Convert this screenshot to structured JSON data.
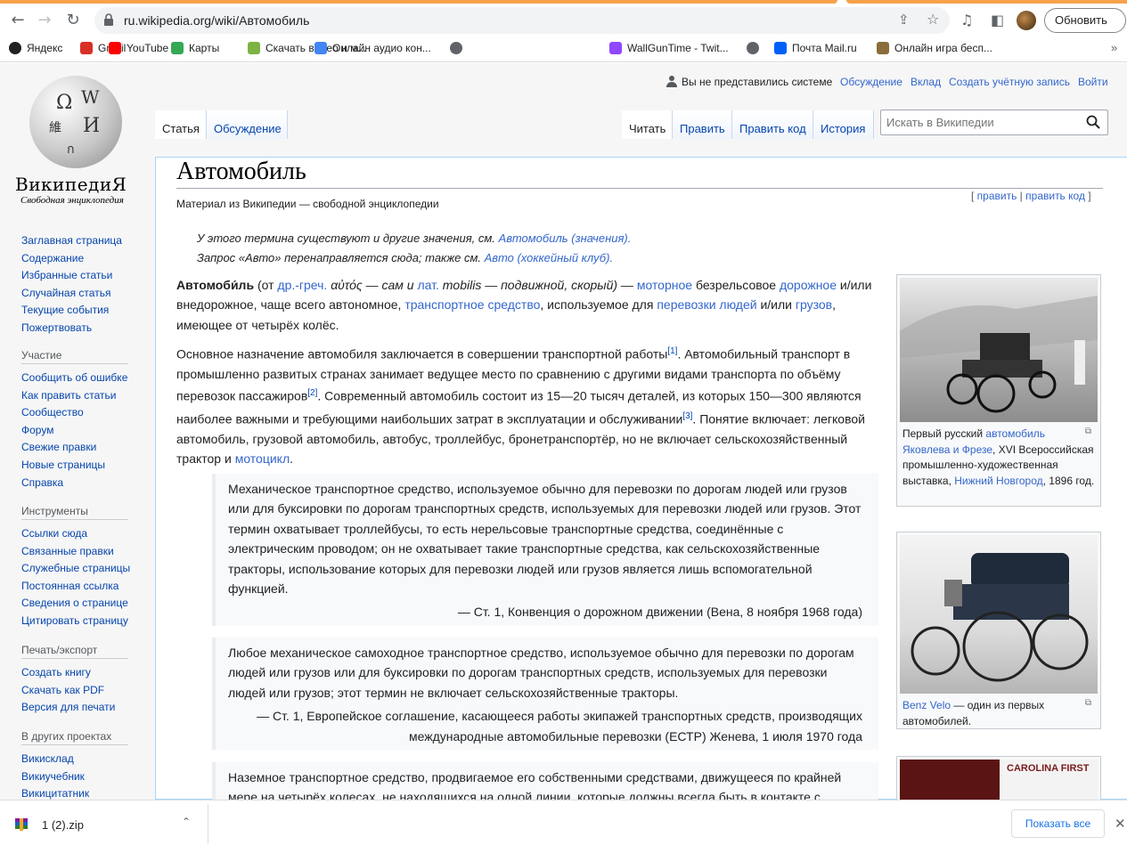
{
  "browser": {
    "url": "ru.wikipedia.org/wiki/Автомобиль",
    "update_button": "Обновить",
    "bookmarks": [
      {
        "label": "Яндекс",
        "icon": "yandex-icon",
        "color": "#202124"
      },
      {
        "label": "Gmail",
        "icon": "gmail-icon",
        "color": "#d93025"
      },
      {
        "label": "YouTube",
        "icon": "youtube-icon",
        "color": "#ff0000"
      },
      {
        "label": "Карты",
        "icon": "maps-icon",
        "color": "#34a853"
      },
      {
        "label": "Скачать видео и м...",
        "icon": "download-icon",
        "color": "#7cb342"
      },
      {
        "label": "Онлайн аудио кон...",
        "icon": "audio-icon",
        "color": "#4285f4"
      },
      {
        "label": "",
        "icon": "globe-icon",
        "color": "#5f6368"
      },
      {
        "label": "WallGunTime - Twit...",
        "icon": "twitch-icon",
        "color": "#9146ff"
      },
      {
        "label": "",
        "icon": "globe-icon",
        "color": "#5f6368"
      },
      {
        "label": "Почта Mail.ru",
        "icon": "mail-icon",
        "color": "#005ff9"
      },
      {
        "label": "Онлайн игра бесп...",
        "icon": "game-icon",
        "color": "#8a6d3b"
      }
    ]
  },
  "wiki": {
    "wordmark": "ВикипедиЯ",
    "tagline": "Свободная энциклопедия",
    "personal": {
      "not_logged": "Вы не представились системе",
      "talk": "Обсуждение",
      "contrib": "Вклад",
      "create": "Создать учётную запись",
      "login": "Войти"
    },
    "tabs": {
      "article": "Статья",
      "discussion": "Обсуждение",
      "read": "Читать",
      "edit": "Править",
      "edit_code": "Править код",
      "history": "История"
    },
    "search_placeholder": "Искать в Википедии",
    "nav_main": [
      "Заглавная страница",
      "Содержание",
      "Избранные статьи",
      "Случайная статья",
      "Текущие события",
      "Пожертвовать"
    ],
    "participation": {
      "heading": "Участие",
      "links": [
        "Сообщить об ошибке",
        "Как править статьи",
        "Сообщество",
        "Форум",
        "Свежие правки",
        "Новые страницы",
        "Справка"
      ]
    },
    "tools": {
      "heading": "Инструменты",
      "links": [
        "Ссылки сюда",
        "Связанные правки",
        "Служебные страницы",
        "Постоянная ссылка",
        "Сведения о странице",
        "Цитировать страницу"
      ]
    },
    "print": {
      "heading": "Печать/экспорт",
      "links": [
        "Создать книгу",
        "Скачать как PDF",
        "Версия для печати"
      ]
    },
    "projects": {
      "heading": "В других проектах",
      "links": [
        "Викисклад",
        "Викиучебник",
        "Викицитатник"
      ]
    }
  },
  "article": {
    "title": "Автомобиль",
    "edit": "править",
    "edit_code": "править код",
    "site_sub": "Материал из Википедии — свободной энциклопедии",
    "hatnote1_text": "У этого термина существуют и другие значения, см.",
    "hatnote1_link": "Автомобиль (значения).",
    "hatnote2_text": "Запрос «Авто» перенаправляется сюда; также см.",
    "hatnote2_link": "Авто (хоккейный клуб).",
    "intro": {
      "bold": "Автомоби́ль",
      "t1": " (от ",
      "greek": "др.-греч.",
      "t2": " αὐτός — сам и ",
      "lat": "лат.",
      "t3": " mobilis — подвижной, скорый) — ",
      "motor": "моторное",
      "t4": " безрельсовое ",
      "road": "дорожное",
      "t5": " и/или внедорожное, чаще всего автономное, ",
      "transport": "транспортное средство",
      "t6": ", используемое для ",
      "people": "перевозки людей",
      "t7": " и/или ",
      "cargo": "грузов",
      "t8": ", имеющее от четырёх колёс."
    },
    "para2": {
      "t1": "Основное назначение автомобиля заключается в совершении транспортной работы",
      "ref1": "[1]",
      "t2": ". Автомобильный транспорт в промышленно развитых странах занимает ведущее место по сравнению с другими видами транспорта по объёму перевозок пассажиров",
      "ref2": "[2]",
      "t3": ". Современный автомобиль состоит из 15—20 тысяч деталей, из которых 150—300 являются наиболее важными и требующими наибольших затрат в эксплуатации и обслуживании",
      "ref3": "[3]",
      "t4": ". Понятие включает: легковой автомобиль, грузовой автомобиль, автобус, троллейбус, бронетранспортёр, но не включает сельскохозяйственный трактор и ",
      "moto": "мотоцикл",
      "t5": "."
    },
    "quote1": {
      "text": "Механическое транспортное средство, используемое обычно для перевозки по дорогам людей или грузов или для буксировки по дорогам транспортных средств, используемых для перевозки людей или грузов. Этот термин охватывает троллейбусы, то есть нерельсовые транспортные средства, соединённые с электрическим проводом; он не охватывает такие транспортные средства, как сельскохозяйственные тракторы, использование которых для перевозки людей или грузов является лишь вспомогательной функцией.",
      "source": "— Ст. 1, Конвенция о дорожном движении (Вена, 8 ноября 1968 года)"
    },
    "quote2": {
      "text": "Любое механическое самоходное транспортное средство, используемое обычно для перевозки по дорогам людей или грузов или для буксировки по дорогам транспортных средств, используемых для перевозки людей или грузов; этот термин не включает сельскохозяйственные тракторы.",
      "source": "— Ст. 1, Европейское соглашение, касающееся работы экипажей транспортных средств, производящих международные автомобильные перевозки (ЕСТР) Женева, 1 июля 1970 года"
    },
    "quote3": {
      "text": "Наземное транспортное средство, продвигаемое его собственными средствами, движущееся по крайней мере на четырёх колесах, не находящихся на одной линии, которые должны всегда быть в контакте с"
    },
    "thumb1": {
      "c1": "Первый русский ",
      "link1": "автомобиль Яковлева и Фрезе",
      "c2": ", XVI Всероссийская промышленно-художественная выставка, ",
      "link2": "Нижний Новгород",
      "c3": ", 1896 год."
    },
    "thumb2": {
      "link1": "Benz Velo",
      "c1": " — один из первых автомобилей."
    },
    "thumb3": {
      "sign": "CAROLINA FIRST"
    }
  },
  "downloads": {
    "file": "1 (2).zip",
    "show_all": "Показать все"
  }
}
